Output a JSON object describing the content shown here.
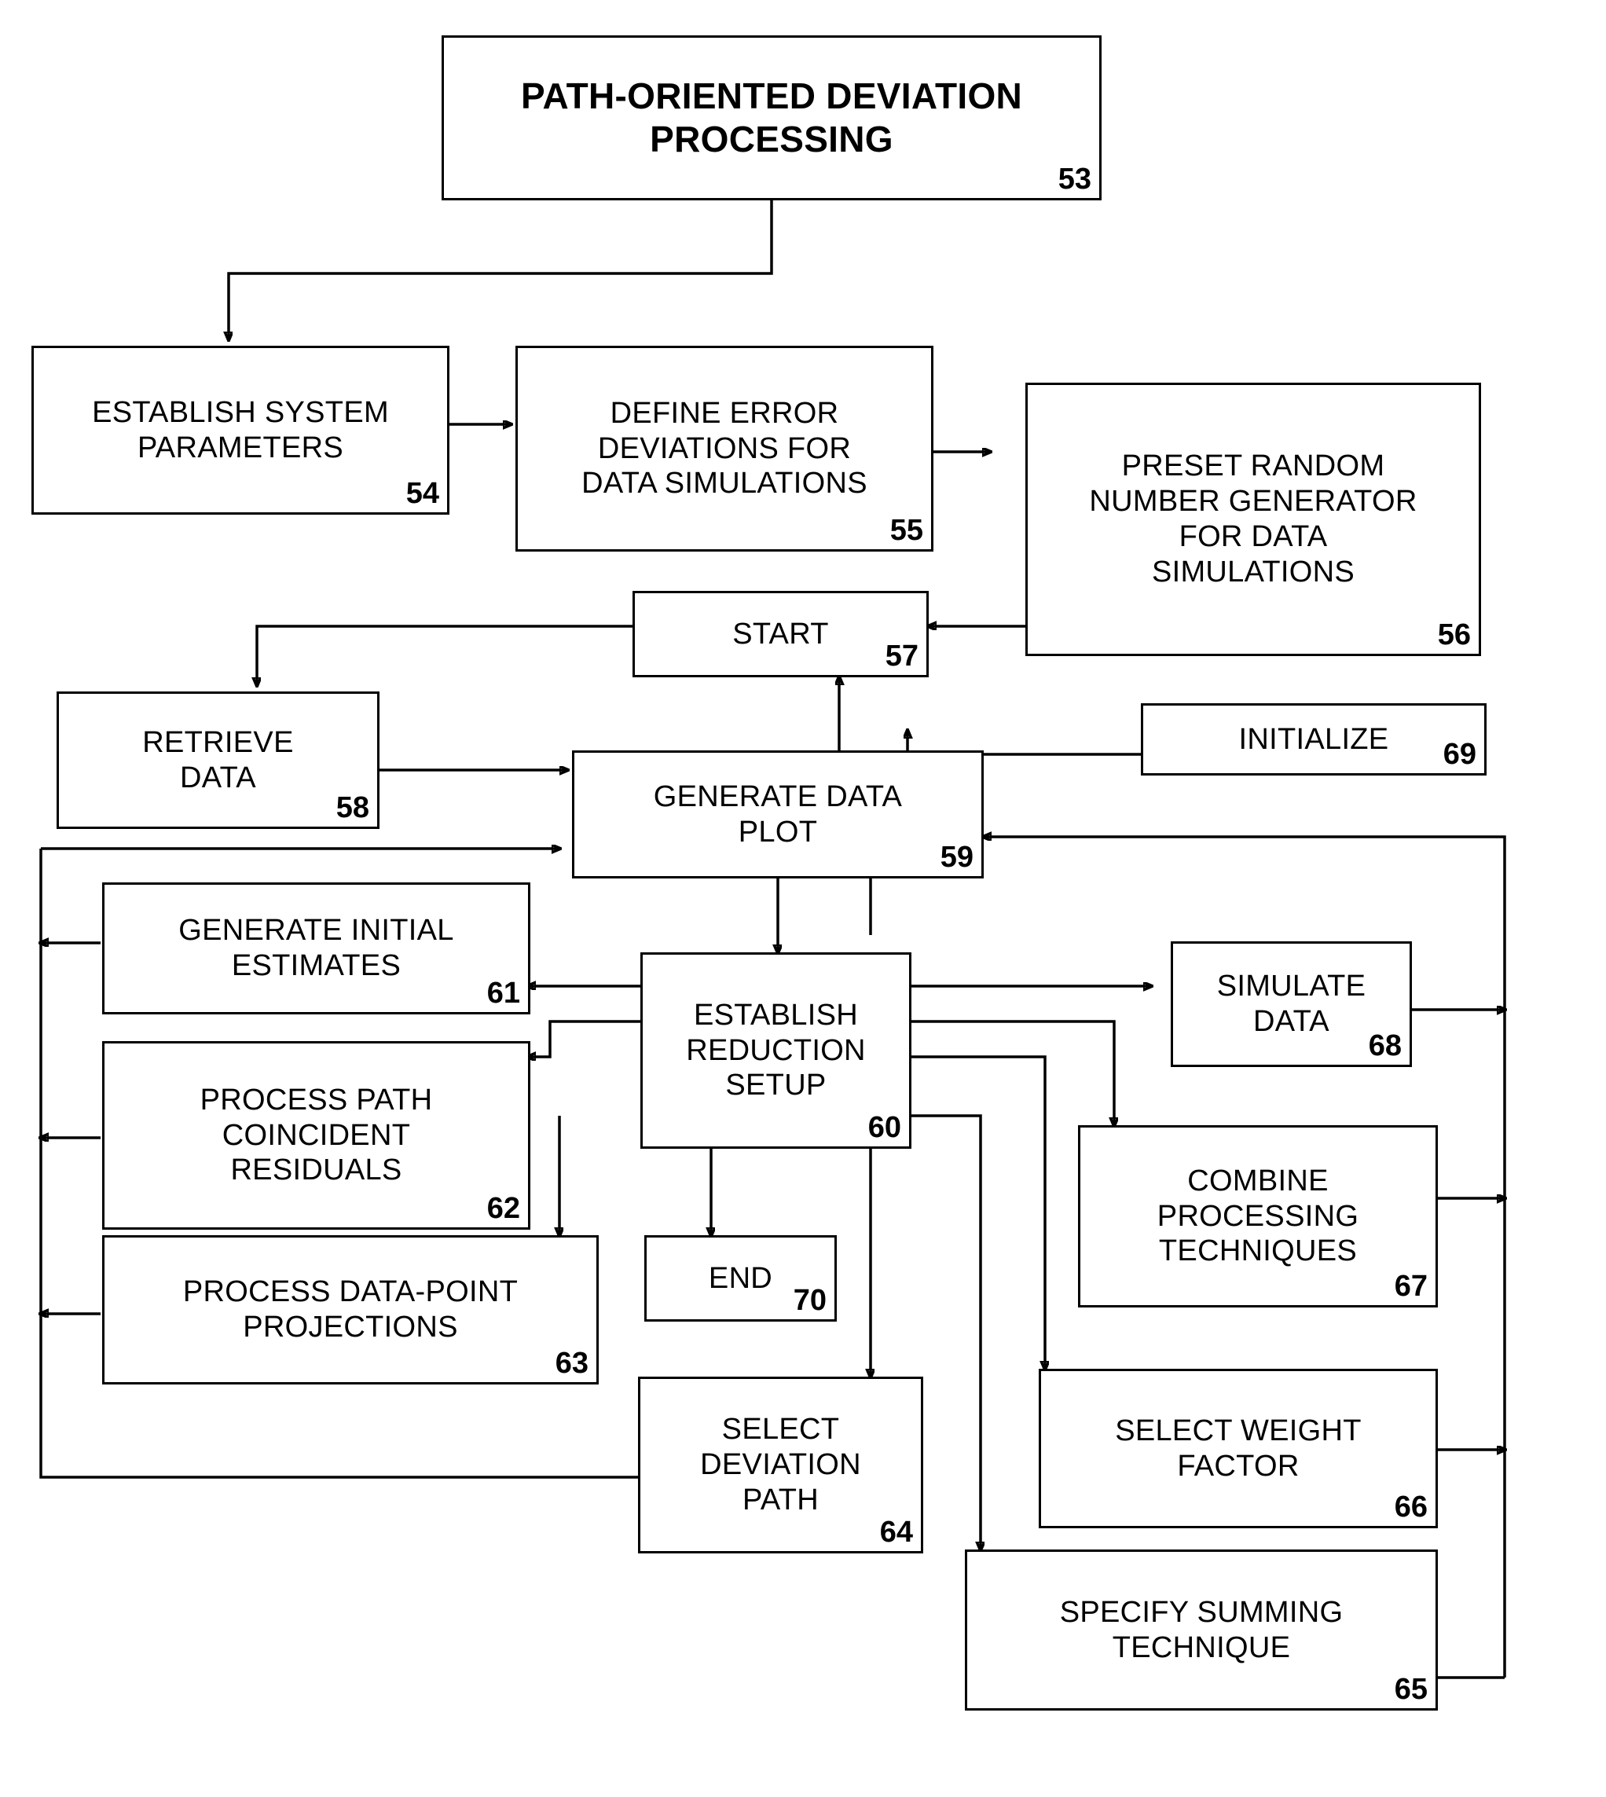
{
  "diagram": {
    "title": "PATH-ORIENTED DEVIATION PROCESSING",
    "nodes": [
      {
        "id": "n53",
        "label": "PATH-ORIENTED DEVIATION\nPROCESSING",
        "num": "53"
      },
      {
        "id": "n54",
        "label": "ESTABLISH SYSTEM\nPARAMETERS",
        "num": "54"
      },
      {
        "id": "n55",
        "label": "DEFINE ERROR\nDEVIATIONS FOR\nDATA SIMULATIONS",
        "num": "55"
      },
      {
        "id": "n56",
        "label": "PRESET RANDOM\nNUMBER GENERATOR\nFOR DATA\nSIMULATIONS",
        "num": "56"
      },
      {
        "id": "n57",
        "label": "START",
        "num": "57"
      },
      {
        "id": "n69",
        "label": "INITIALIZE",
        "num": "69"
      },
      {
        "id": "n58",
        "label": "RETRIEVE\nDATA",
        "num": "58"
      },
      {
        "id": "n59",
        "label": "GENERATE DATA\nPLOT",
        "num": "59"
      },
      {
        "id": "n61",
        "label": "GENERATE INITIAL\nESTIMATES",
        "num": "61"
      },
      {
        "id": "n60",
        "label": "ESTABLISH\nREDUCTION\nSETUP",
        "num": "60"
      },
      {
        "id": "n68",
        "label": "SIMULATE\nDATA",
        "num": "68"
      },
      {
        "id": "n62",
        "label": "PROCESS PATH\nCOINCIDENT\nRESIDUALS",
        "num": "62"
      },
      {
        "id": "n67",
        "label": "COMBINE\nPROCESSING\nTECHNIQUES",
        "num": "67"
      },
      {
        "id": "n63",
        "label": "PROCESS DATA-POINT\nPROJECTIONS",
        "num": "63"
      },
      {
        "id": "n70",
        "label": "END",
        "num": "70"
      },
      {
        "id": "n64",
        "label": "SELECT\nDEVIATION\nPATH",
        "num": "64"
      },
      {
        "id": "n66",
        "label": "SELECT WEIGHT\nFACTOR",
        "num": "66"
      },
      {
        "id": "n65",
        "label": "SPECIFY SUMMING\nTECHNIQUE",
        "num": "65"
      }
    ]
  }
}
